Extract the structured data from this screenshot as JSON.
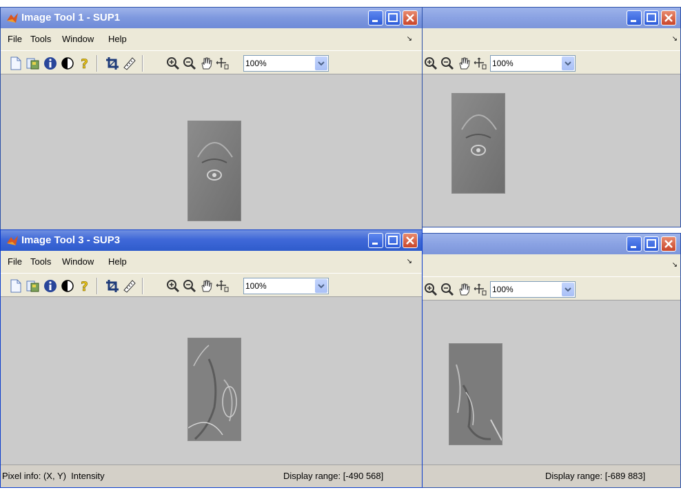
{
  "windows": [
    {
      "id": "w1",
      "title": "Image Tool 1 - SUP1",
      "menu": [
        "File",
        "Tools",
        "Window",
        "Help"
      ],
      "zoom": "100%",
      "status_left": "",
      "status_right": ""
    },
    {
      "id": "w2",
      "title": "",
      "menu": [],
      "zoom": "100%",
      "status_left": "",
      "status_right": ""
    },
    {
      "id": "w3",
      "title": "Image Tool 3 - SUP3",
      "menu": [
        "File",
        "Tools",
        "Window",
        "Help"
      ],
      "zoom": "100%",
      "status_left": "Pixel info: (X, Y)  Intensity",
      "status_right": "Display range: [-490 568]"
    },
    {
      "id": "w4",
      "title": "",
      "menu": [],
      "zoom": "100%",
      "status_left": "",
      "status_right": "Display range: [-689 883]"
    }
  ],
  "toolbar_icons": [
    "new-figure-icon",
    "copy-icon",
    "info-icon",
    "contrast-icon",
    "help-icon",
    "crop-icon",
    "measure-icon",
    "zoom-in-icon",
    "zoom-out-icon",
    "pan-hand-icon",
    "pixel-region-icon"
  ],
  "colors": {
    "active_title": "#2f5ccc",
    "inactive_title": "#8aa2e3",
    "close_button": "#c9452a",
    "viewport": "#cbcbcb"
  }
}
